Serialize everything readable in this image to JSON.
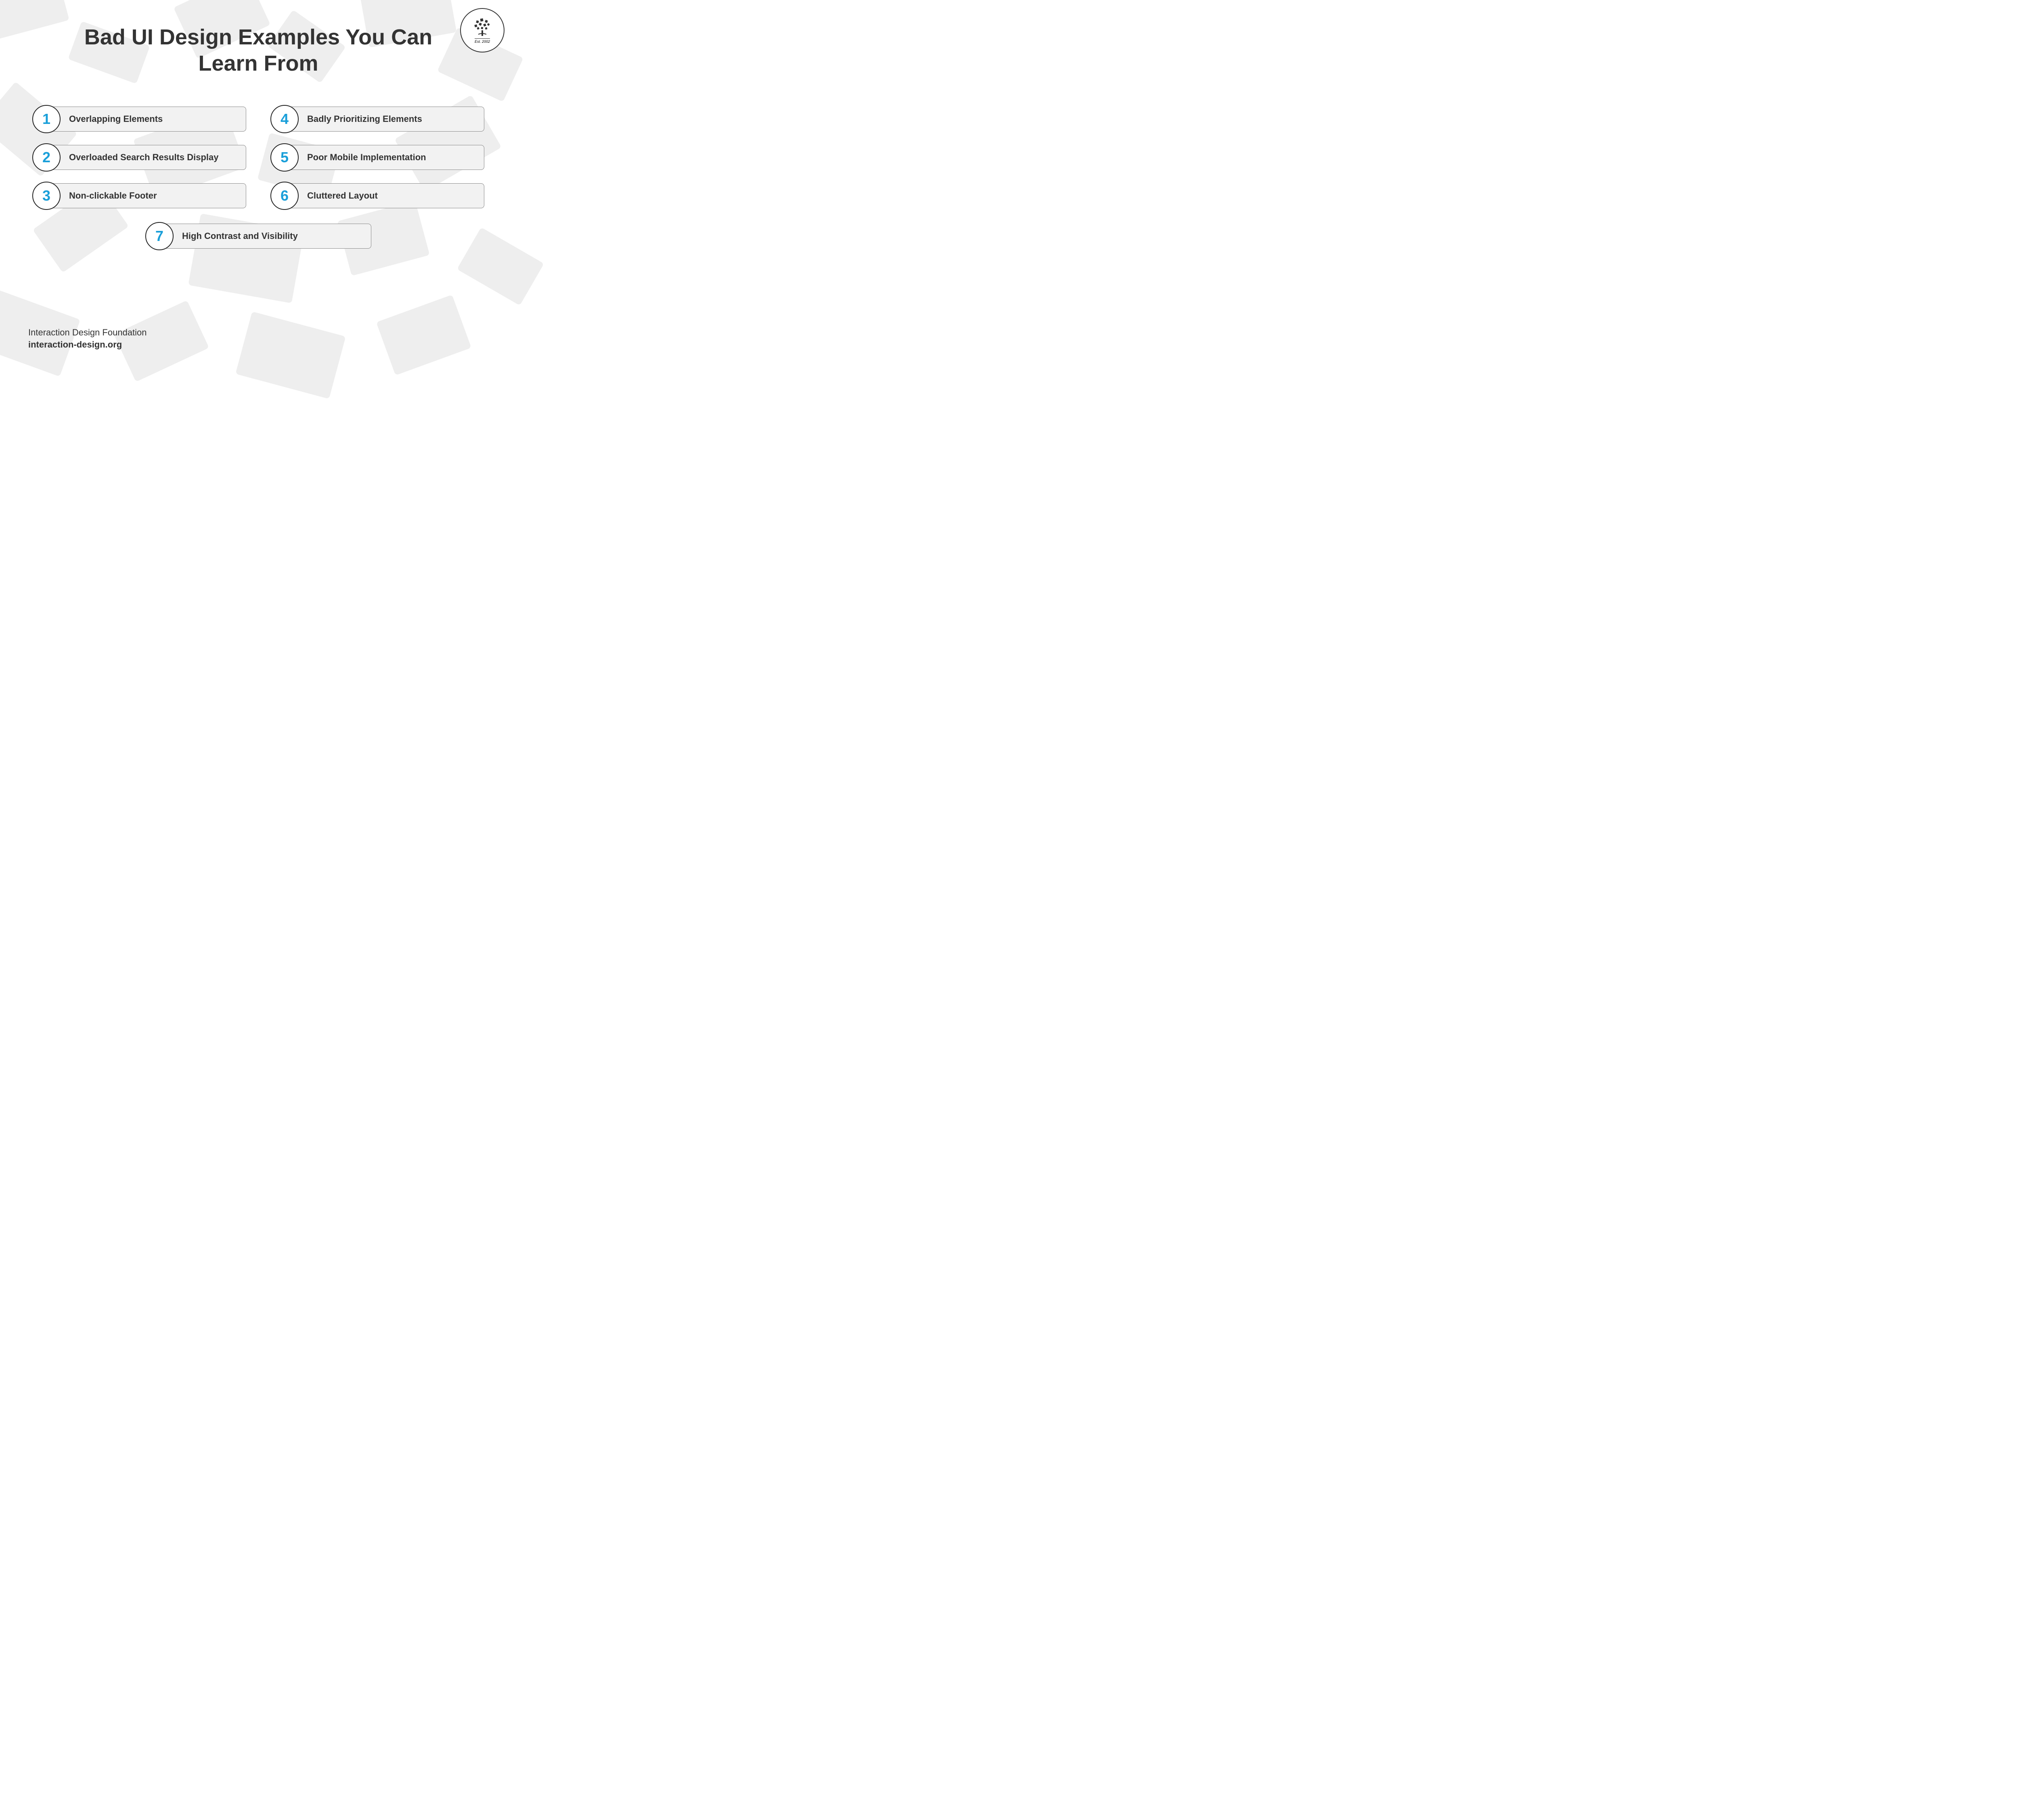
{
  "title": "Bad UI Design Examples You Can Learn From",
  "items": [
    {
      "number": "1",
      "label": "Overlapping Elements"
    },
    {
      "number": "2",
      "label": "Overloaded Search Results Display"
    },
    {
      "number": "3",
      "label": "Non-clickable Footer"
    },
    {
      "number": "4",
      "label": "Badly Prioritizing Elements"
    },
    {
      "number": "5",
      "label": "Poor Mobile Implementation"
    },
    {
      "number": "6",
      "label": "Cluttered Layout"
    },
    {
      "number": "7",
      "label": "High Contrast and Visibility"
    }
  ],
  "footer": {
    "org": "Interaction Design Foundation",
    "url": "interaction-design.org"
  },
  "logo": {
    "est": "Est. 2002",
    "name": "INTERACTION DESIGN FOUNDATION"
  }
}
